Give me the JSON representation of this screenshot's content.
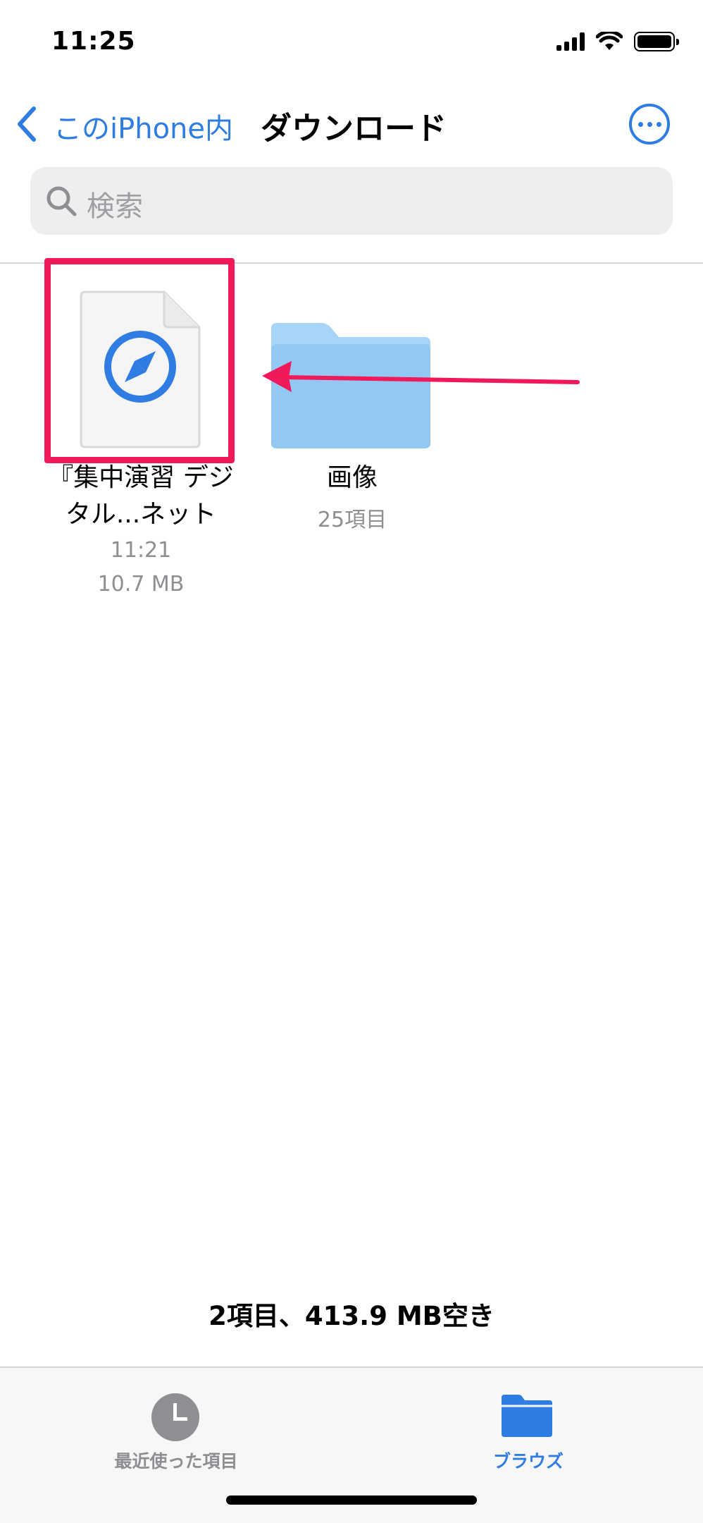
{
  "status_bar": {
    "time": "11:25"
  },
  "nav": {
    "back_label": "このiPhone内",
    "title": "ダウンロード"
  },
  "search": {
    "placeholder": "検索"
  },
  "items": [
    {
      "name": "『集中演習 デジタル...ネット",
      "time": "11:21",
      "size": "10.7 MB",
      "icon": "safari-document-icon",
      "highlighted": true
    },
    {
      "name": "画像",
      "count": "25項目",
      "icon": "folder-icon"
    }
  ],
  "storage_info": "2項目、413.9 MB空き",
  "tab_bar": {
    "recent_label": "最近使った項目",
    "browse_label": "ブラウズ",
    "active_tab": "browse"
  },
  "colors": {
    "accent": "#2f7de2",
    "highlight": "#f2195b",
    "folder": "#a6d5f7",
    "secondary_text": "#8e8e93"
  }
}
